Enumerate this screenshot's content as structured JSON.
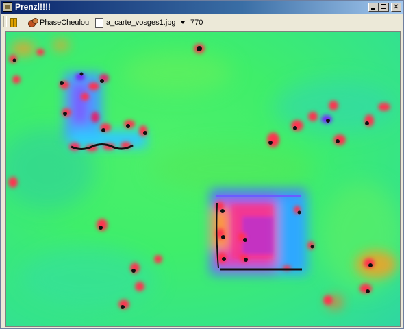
{
  "window": {
    "title": "Prenzl!!!!"
  },
  "toolbar": {
    "pause_icon": "pause-icon",
    "effect_label": "PhaseCheulou",
    "file_label": "a_carte_vosges1.jpg",
    "value_label": "770"
  },
  "canvas": {
    "description_icon": "image-canvas"
  },
  "colors": {
    "title_start": "#0a246a",
    "title_end": "#a6caf0",
    "background_green": "#3fee6a",
    "accent_magenta": "#e33fb0",
    "accent_blue": "#4a6bff",
    "accent_red": "#ff3050",
    "accent_orange": "#ff9a20"
  }
}
